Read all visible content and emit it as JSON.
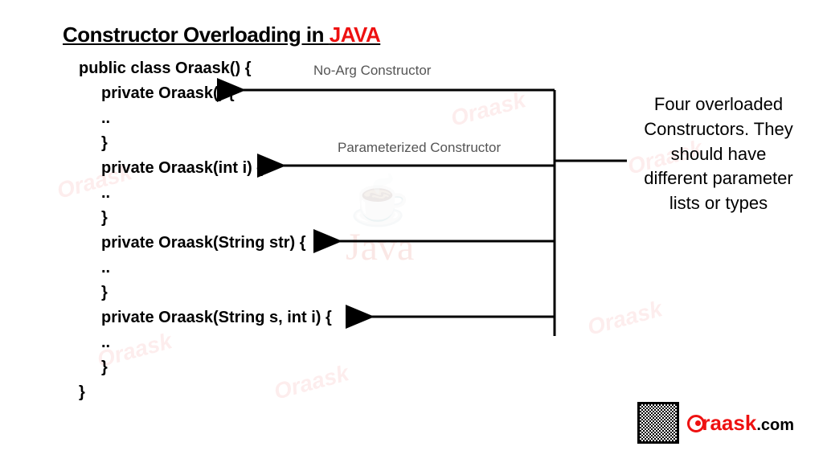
{
  "title_prefix": "Constructor Overloading in ",
  "title_accent": "JAVA",
  "code": {
    "l1": "public class Oraask() {",
    "l2": "private Oraask() {",
    "l3": "..",
    "l4": "}",
    "l5": "private Oraask(int i) {",
    "l6": "..",
    "l7": "}",
    "l8": "private Oraask(String str) {",
    "l9": "..",
    "l10": "}",
    "l11": "private Oraask(String s, int i) {",
    "l12": "..",
    "l13": "}",
    "l14": "}"
  },
  "labels": {
    "noarg": "No-Arg Constructor",
    "param": "Parameterized Constructor"
  },
  "side_text": "Four overloaded Constructors. They should have different parameter lists or types",
  "brand": {
    "name": "raask",
    "suffix": ".com"
  },
  "watermark": "Oraask",
  "java_wm": "Java"
}
